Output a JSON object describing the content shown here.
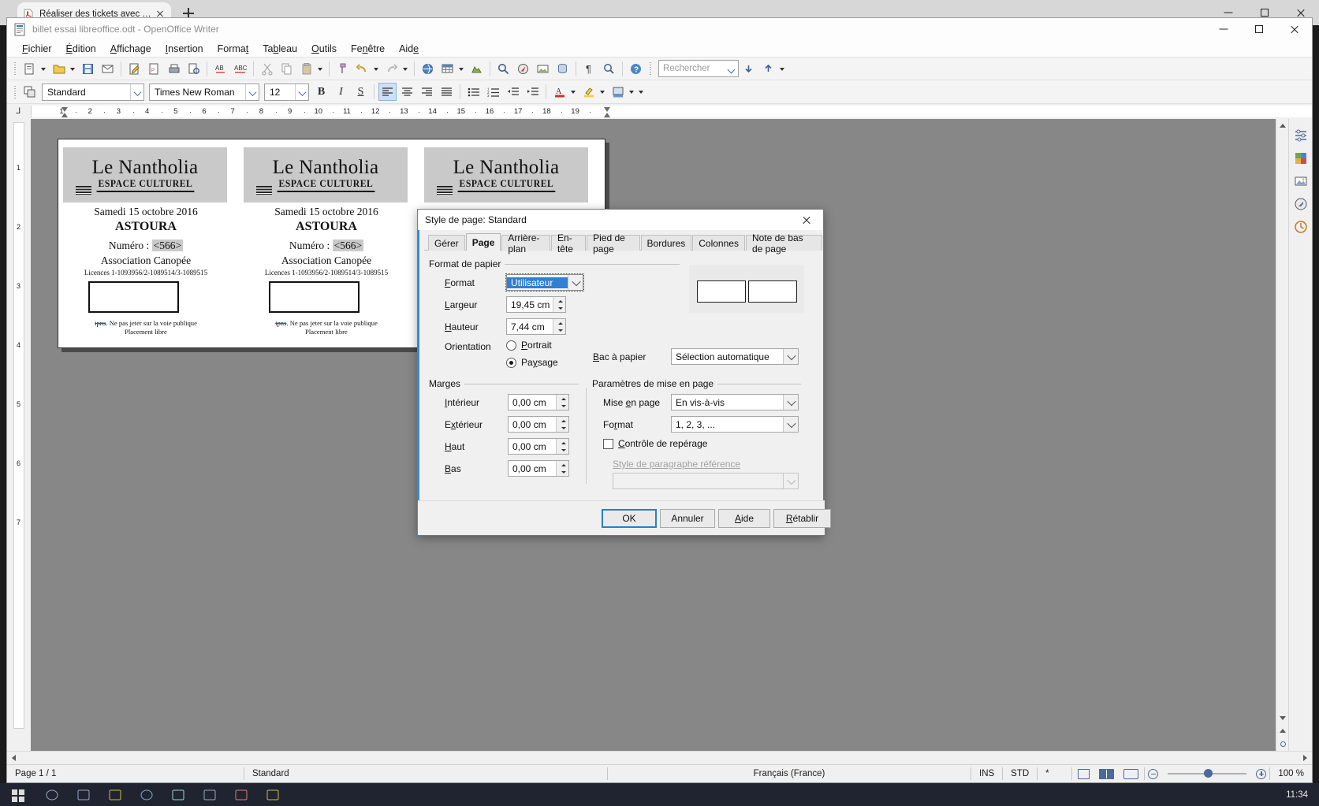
{
  "browser": {
    "tab": {
      "title": "Réaliser des tickets avec T...",
      "favicon": "pdf-icon",
      "close": "close-icon"
    },
    "new_tab": "new-tab-icon",
    "window_controls": [
      "minimize-icon",
      "maximize-icon",
      "close-icon"
    ]
  },
  "app": {
    "title": "billet essai libreoffice.odt - OpenOffice Writer",
    "icon": "writer-document-icon",
    "menus": [
      {
        "label": "Fichier"
      },
      {
        "label": "Édition"
      },
      {
        "label": "Affichage"
      },
      {
        "label": "Insertion"
      },
      {
        "label": "Format"
      },
      {
        "label": "Tableau"
      },
      {
        "label": "Outils"
      },
      {
        "label": "Fenêtre"
      },
      {
        "label": "Aide"
      }
    ]
  },
  "formatting_bar": {
    "paragraph_style": "Standard",
    "font_name": "Times New Roman",
    "font_size": "12",
    "bold": "B",
    "italic": "I",
    "underline": "S"
  },
  "standard_bar": {
    "search_placeholder": "Rechercher"
  },
  "ruler": {
    "numbers": [
      "1",
      "2",
      "3",
      "4",
      "5",
      "6",
      "7",
      "8",
      "9",
      "10",
      "11",
      "12",
      "13",
      "14",
      "15",
      "16",
      "17",
      "18",
      "19"
    ],
    "vertical_numbers": [
      "1",
      "2",
      "3",
      "4",
      "5",
      "6",
      "7"
    ]
  },
  "document": {
    "tickets": [
      {
        "logo_main": "Le Nantholia",
        "logo_sub": "ESPACE CULTUREL",
        "date": "Samedi 15 octobre 2016",
        "show": "ASTOURA",
        "number_label": "Numéro",
        "number_sep": ":",
        "number_value": "<566>",
        "association": "Association Canopée",
        "licences": "Licences 1-1093956/2-1089514/3-1089515",
        "footer1_strike": "ipns",
        "footer1": ". Ne pas jeter sur la voie publique",
        "footer2": "Placement libre"
      },
      {
        "logo_main": "Le Nantholia",
        "logo_sub": "ESPACE CULTUREL",
        "date": "Samedi 15 octobre 2016",
        "show": "ASTOURA",
        "number_label": "Numéro",
        "number_sep": ":",
        "number_value": "<566>",
        "association": "Association Canopée",
        "licences": "Licences 1-1093956/2-1089514/3-1089515",
        "footer1_strike": "ipns",
        "footer1": ". Ne pas jeter sur la voie publique",
        "footer2": "Placement libre"
      },
      {
        "logo_main": "Le Nantholia",
        "logo_sub": "ESPACE CULTUREL",
        "date": "",
        "show": "",
        "number_label": "",
        "number_sep": "",
        "number_value": "",
        "association": "",
        "licences": "",
        "footer1_strike": "",
        "footer1": "",
        "footer2": ""
      }
    ]
  },
  "dialog": {
    "title": "Style de page: Standard",
    "close": "close-icon",
    "tabs": [
      {
        "label": "Gérer",
        "active": false
      },
      {
        "label": "Page",
        "active": true
      },
      {
        "label": "Arrière-plan",
        "active": false
      },
      {
        "label": "En-tête",
        "active": false
      },
      {
        "label": "Pied de page",
        "active": false
      },
      {
        "label": "Bordures",
        "active": false
      },
      {
        "label": "Colonnes",
        "active": false
      },
      {
        "label": "Note de bas de page",
        "active": false
      }
    ],
    "paper_group": {
      "legend": "Format de papier",
      "format_label": "Format",
      "format_value": "Utilisateur",
      "width_label": "Largeur",
      "width_value": "19,45 cm",
      "height_label": "Hauteur",
      "height_value": "7,44 cm",
      "orientation_label": "Orientation",
      "portrait_label": "Portrait",
      "landscape_label": "Paysage",
      "orientation_selected": "Paysage",
      "tray_label": "Bac à papier",
      "tray_value": "Sélection automatique"
    },
    "margins_group": {
      "legend": "Marges",
      "inner_label": "Intérieur",
      "inner_value": "0,00 cm",
      "outer_label": "Extérieur",
      "outer_value": "0,00 cm",
      "top_label": "Haut",
      "top_value": "0,00 cm",
      "bottom_label": "Bas",
      "bottom_value": "0,00 cm"
    },
    "layout_group": {
      "legend": "Paramètres de mise en page",
      "layout_label": "Mise en page",
      "layout_value": "En vis-à-vis",
      "format_label": "Format",
      "format_value": "1, 2, 3, ...",
      "register_label": "Contrôle de repérage",
      "register_checked": false,
      "ref_style_label": "Style de paragraphe référence",
      "ref_style_value": ""
    },
    "buttons": {
      "ok": "OK",
      "cancel": "Annuler",
      "help": "Aide",
      "reset": "Rétablir"
    }
  },
  "statusbar": {
    "page": "Page 1 / 1",
    "style": "Standard",
    "language": "Français (France)",
    "insert_mode": "INS",
    "selection_mode": "STD",
    "modified": "*",
    "zoom": "100 %",
    "view_single": "single-page-view-icon",
    "view_multi": "multi-page-view-icon",
    "view_book": "book-view-icon"
  },
  "sidebar": {
    "items": [
      {
        "name": "sidebar-settings-icon"
      },
      {
        "name": "sidebar-properties-icon"
      },
      {
        "name": "sidebar-gallery-icon"
      },
      {
        "name": "sidebar-navigator-icon"
      },
      {
        "name": "sidebar-styles-icon"
      }
    ]
  },
  "taskbar": {
    "clock": "11:34"
  },
  "colors": {
    "accent": "#2c7ec4",
    "highlight": "#2f7fd4",
    "tab_bg": "#f3f3f3",
    "canvas": "#878787"
  }
}
